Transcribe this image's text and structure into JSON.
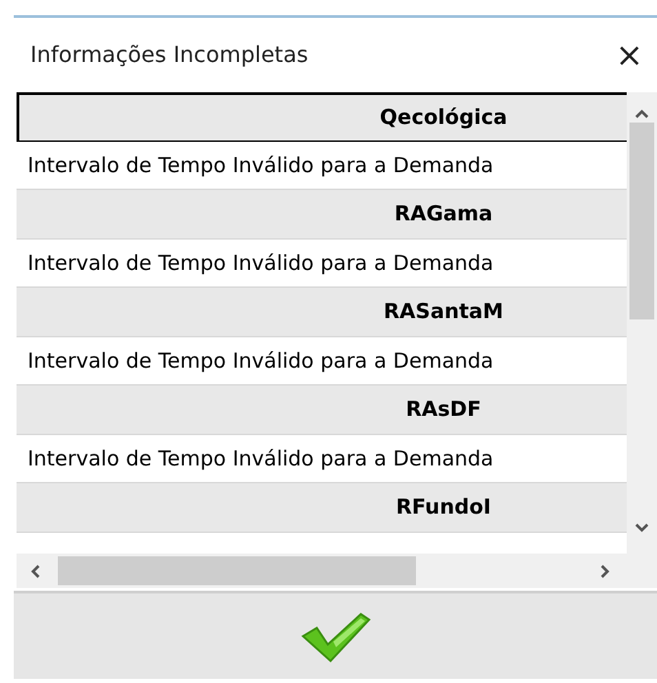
{
  "window": {
    "title": "Informações Incompletas",
    "close": "×"
  },
  "rows": [
    {
      "kind": "header",
      "text": "Qecológica",
      "selected": true
    },
    {
      "kind": "message",
      "text": "Intervalo de Tempo Inválido para a Demanda",
      "selected": false
    },
    {
      "kind": "header",
      "text": "RAGama",
      "selected": false
    },
    {
      "kind": "message",
      "text": "Intervalo de Tempo Inválido para a Demanda",
      "selected": false
    },
    {
      "kind": "header",
      "text": "RASantaM",
      "selected": false
    },
    {
      "kind": "message",
      "text": "Intervalo de Tempo Inválido para a Demanda",
      "selected": false
    },
    {
      "kind": "header",
      "text": "RAsDF",
      "selected": false
    },
    {
      "kind": "message",
      "text": "Intervalo de Tempo Inválido para a Demanda",
      "selected": false
    },
    {
      "kind": "header",
      "text": "RFundoI",
      "selected": false
    }
  ]
}
